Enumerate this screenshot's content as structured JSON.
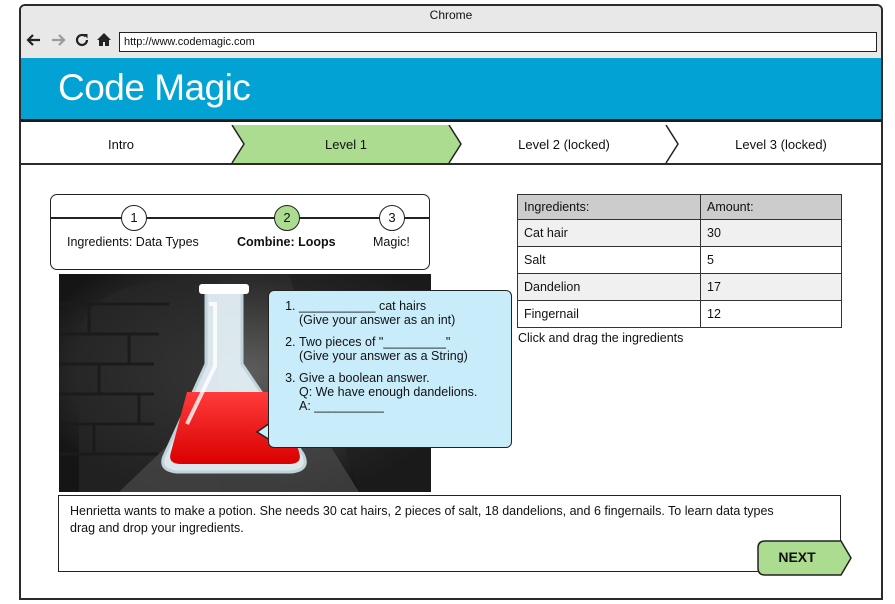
{
  "browser": {
    "title": "Chrome",
    "url": "http://www.codemagic.com",
    "icons": [
      "back-arrow-icon",
      "forward-arrow-icon",
      "reload-icon",
      "home-icon"
    ]
  },
  "app": {
    "brand": "Code Magic",
    "brand_color": "#02a2d4"
  },
  "tabs": [
    {
      "label": "Intro"
    },
    {
      "label": "Level 1",
      "active": true,
      "color": "#acdc8f"
    },
    {
      "label": "Level 2 (locked)"
    },
    {
      "label": "Level 3 (locked)"
    }
  ],
  "progress": {
    "steps": [
      {
        "number": "1",
        "label": "Ingredients: Data Types"
      },
      {
        "number": "2",
        "label": "Combine: Loops",
        "active": true
      },
      {
        "number": "3",
        "label": "Magic!"
      }
    ]
  },
  "questions": [
    {
      "line1": "___________ cat hairs",
      "line2": "(Give your answer as an int)"
    },
    {
      "line1": "Two pieces of \"_________\"",
      "line2": "(Give your answer as a String)"
    },
    {
      "line1": "Give a boolean answer.",
      "line2": "Q: We have enough dandelions.",
      "line3": "A: __________"
    }
  ],
  "ingredients": {
    "headers": [
      "Ingredients:",
      "Amount:"
    ],
    "rows": [
      [
        "Cat hair",
        "30"
      ],
      [
        "Salt",
        "5"
      ],
      [
        "Dandelion",
        "17"
      ],
      [
        "Fingernail",
        "12"
      ]
    ],
    "hint": "Click and drag the ingredients"
  },
  "story": "Henrietta wants to make a potion. She needs 30 cat hairs, 2 pieces of salt, 18 dandelions, and 6 fingernails. To learn data types drag and drop your ingredients.",
  "next_label": "NEXT"
}
